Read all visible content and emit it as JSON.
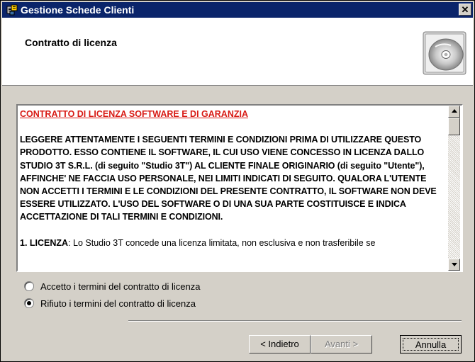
{
  "window": {
    "title": "Gestione Schede Clienti",
    "close_label": "✕"
  },
  "header": {
    "title": "Contratto di licenza",
    "icon": "cd-icon"
  },
  "eula": {
    "heading": "CONTRATTO DI LICENZA SOFTWARE E DI GARANZIA",
    "paragraph1": "LEGGERE ATTENTAMENTE I SEGUENTI TERMINI E CONDIZIONI PRIMA DI UTILIZZARE QUESTO PRODOTTO. ESSO CONTIENE IL SOFTWARE, IL CUI USO VIENE CONCESSO IN LICENZA DALLO STUDIO 3T S.R.L. (di seguito \"Studio 3T\") AL CLIENTE FINALE ORIGINARIO (di seguito \"Utente\"), AFFINCHE' NE FACCIA USO PERSONALE, NEI LIMITI INDICATI DI SEGUITO. QUALORA L'UTENTE NON ACCETTI I TERMINI E LE CONDIZIONI DEL PRESENTE CONTRATTO, IL SOFTWARE NON DEVE ESSERE UTILIZZATO. L'USO DEL SOFTWARE O DI UNA SUA PARTE COSTITUISCE E INDICA ACCETTAZIONE DI TALI TERMINI E CONDIZIONI.",
    "paragraph2_label": "1. LICENZA",
    "paragraph2_text": ": Lo Studio 3T concede una licenza limitata, non esclusiva e non trasferibile se",
    "heading_color": "#d81a14"
  },
  "options": {
    "accept_label": "Accetto i termini del contratto di licenza",
    "reject_label": "Rifiuto i termini del contratto di licenza",
    "selected": "reject"
  },
  "buttons": {
    "back_label": "< Indietro",
    "next_label": "Avanti >",
    "cancel_label": "Annulla"
  }
}
